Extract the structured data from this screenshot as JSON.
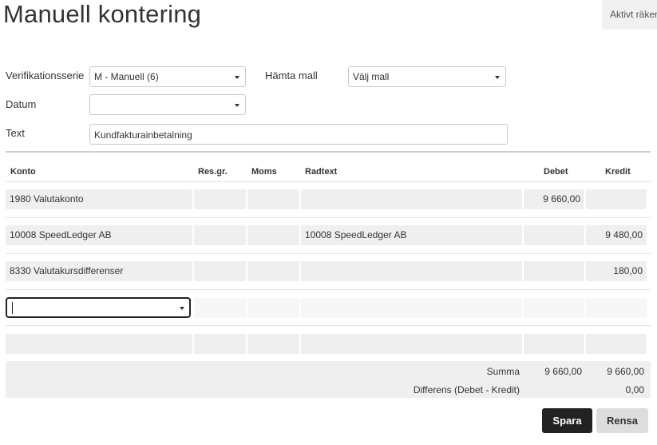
{
  "page": {
    "title": "Manuell kontering",
    "year_badge": "Aktivt räkenskapsår"
  },
  "form": {
    "series_label": "Verifikationsserie",
    "series_value": "M - Manuell (6)",
    "template_label": "Hämta mall",
    "template_value": "Välj mall",
    "date_label": "Datum",
    "date_value": "",
    "text_label": "Text",
    "text_value": "Kundfakturainbetalning"
  },
  "table": {
    "headers": {
      "konto": "Konto",
      "resgr": "Res.gr.",
      "moms": "Moms",
      "radtext": "Radtext",
      "debet": "Debet",
      "kredit": "Kredit"
    },
    "rows": [
      {
        "konto": "1980 Valutakonto",
        "resgr": "",
        "moms": "",
        "radtext": "",
        "debet": "9 660,00",
        "kredit": ""
      },
      {
        "konto": "10008 SpeedLedger AB",
        "resgr": "",
        "moms": "",
        "radtext": "10008 SpeedLedger AB",
        "debet": "",
        "kredit": "9 480,00"
      },
      {
        "konto": "8330 Valutakursdifferenser",
        "resgr": "",
        "moms": "",
        "radtext": "",
        "debet": "",
        "kredit": "180,00"
      }
    ]
  },
  "summary": {
    "sum_label": "Summa",
    "sum_debet": "9 660,00",
    "sum_kredit": "9 660,00",
    "diff_label": "Differens (Debet - Kredit)",
    "diff_value": "0,00"
  },
  "actions": {
    "save": "Spara",
    "clear": "Rensa"
  }
}
